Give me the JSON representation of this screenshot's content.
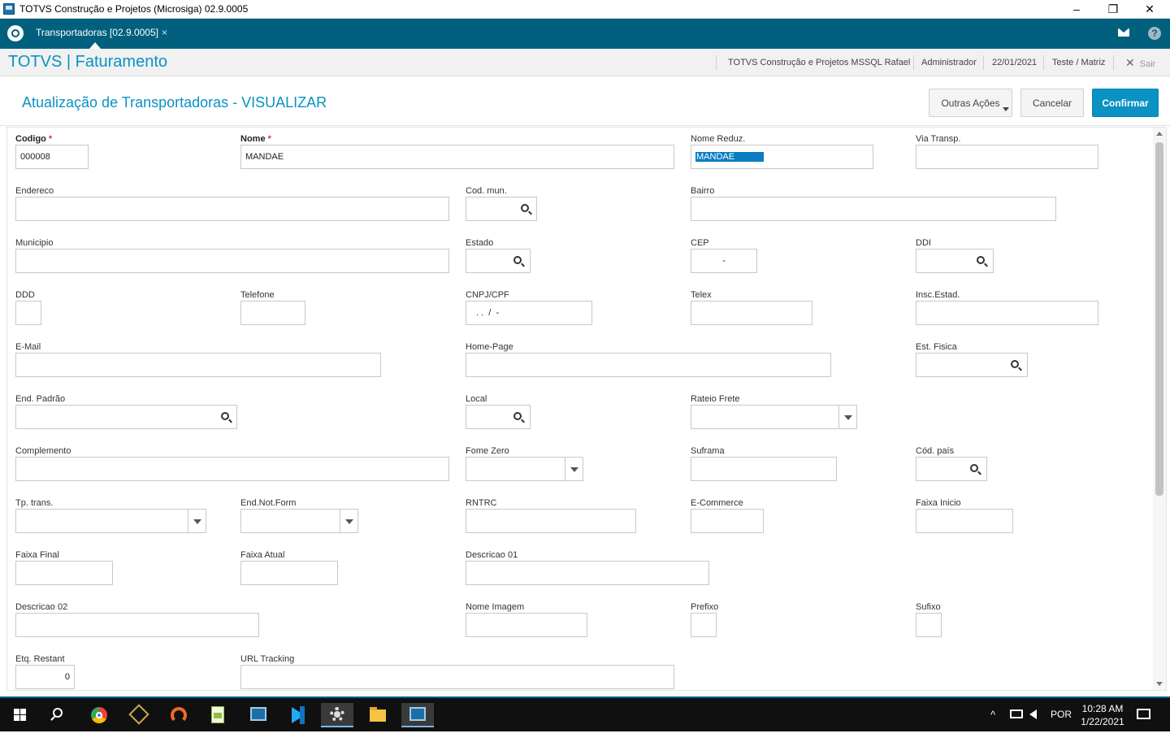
{
  "window": {
    "title": "TOTVS Construção e Projetos (Microsiga) 02.9.0005",
    "minimize": "–",
    "restore": "❐",
    "close": "✕"
  },
  "tabbar": {
    "tab_label": "Transportadoras [02.9.0005]",
    "tab_close": "×",
    "help": "?"
  },
  "header": {
    "brand": "TOTVS | Faturamento",
    "company": "TOTVS Construção e Projetos MSSQL Rafael",
    "user": "Administrador",
    "date": "22/01/2021",
    "branch": "Teste / Matriz",
    "exit_label": "Sair",
    "exit_icon": "✕"
  },
  "page": {
    "title": "Atualização de Transportadoras - VISUALIZAR",
    "other_actions": "Outras Ações",
    "cancel": "Cancelar",
    "confirm": "Confirmar"
  },
  "fields": {
    "codigo": {
      "label": "Codigo",
      "value": "000008"
    },
    "nome": {
      "label": "Nome",
      "value": "MANDAE"
    },
    "nome_reduz": {
      "label": "Nome Reduz.",
      "value": "MANDAE"
    },
    "via_transp": {
      "label": "Via Transp.",
      "value": ""
    },
    "endereco": {
      "label": "Endereco",
      "value": ""
    },
    "cod_mun": {
      "label": "Cod. mun.",
      "value": ""
    },
    "bairro": {
      "label": "Bairro",
      "value": ""
    },
    "municipio": {
      "label": "Municipio",
      "value": ""
    },
    "estado": {
      "label": "Estado",
      "value": ""
    },
    "cep": {
      "label": "CEP",
      "value": "-"
    },
    "ddi": {
      "label": "DDI",
      "value": ""
    },
    "ddd": {
      "label": "DDD",
      "value": ""
    },
    "telefone": {
      "label": "Telefone",
      "value": ""
    },
    "cnpj": {
      "label": "CNPJ/CPF",
      "value": ". .  /  -"
    },
    "telex": {
      "label": "Telex",
      "value": ""
    },
    "insc_estad": {
      "label": "Insc.Estad.",
      "value": ""
    },
    "email": {
      "label": "E-Mail",
      "value": ""
    },
    "home_page": {
      "label": "Home-Page",
      "value": ""
    },
    "est_fisica": {
      "label": "Est. Fisica",
      "value": ""
    },
    "end_padrao": {
      "label": "End. Padrão",
      "value": ""
    },
    "local": {
      "label": "Local",
      "value": ""
    },
    "rateio_frete": {
      "label": "Rateio Frete",
      "value": ""
    },
    "complemento": {
      "label": "Complemento",
      "value": ""
    },
    "fome_zero": {
      "label": "Fome Zero",
      "value": ""
    },
    "suframa": {
      "label": "Suframa",
      "value": ""
    },
    "cod_pais": {
      "label": "Cód. país",
      "value": ""
    },
    "tp_trans": {
      "label": "Tp. trans.",
      "value": ""
    },
    "end_not_form": {
      "label": "End.Not.Form",
      "value": ""
    },
    "rntrc": {
      "label": "RNTRC",
      "value": ""
    },
    "ecommerce": {
      "label": "E-Commerce",
      "value": ""
    },
    "faixa_inicio": {
      "label": "Faixa Inicio",
      "value": ""
    },
    "faixa_final": {
      "label": "Faixa Final",
      "value": ""
    },
    "faixa_atual": {
      "label": "Faixa Atual",
      "value": ""
    },
    "descricao01": {
      "label": "Descricao 01",
      "value": ""
    },
    "descricao02": {
      "label": "Descricao 02",
      "value": ""
    },
    "nome_imagem": {
      "label": "Nome Imagem",
      "value": ""
    },
    "prefixo": {
      "label": "Prefixo",
      "value": ""
    },
    "sufixo": {
      "label": "Sufixo",
      "value": ""
    },
    "etq_restant": {
      "label": "Etq. Restant",
      "value": "0"
    },
    "url_tracking": {
      "label": "URL Tracking",
      "value": ""
    }
  },
  "required_mark": "*",
  "taskbar": {
    "language": "POR",
    "time": "10:28 AM",
    "date": "1/22/2021",
    "tray_chevron": "^"
  },
  "colors": {
    "brand_teal": "#00607e",
    "accent_blue": "#0a92c4"
  }
}
